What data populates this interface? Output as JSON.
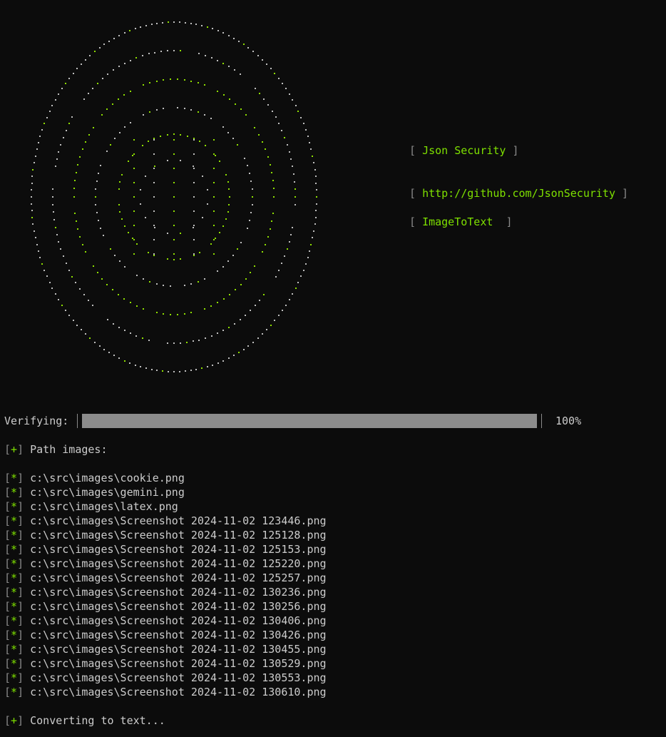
{
  "banner": {
    "name": "Json Security",
    "url": "http://github.com/JsonSecurity",
    "tool": "ImageToText"
  },
  "progress": {
    "label": "Verifying:",
    "percent_text": "100%",
    "value": 1.0
  },
  "sections": {
    "path_marker": "+",
    "path_label": "Path images:",
    "convert_marker": "+",
    "convert_label": "Converting to text..."
  },
  "files": [
    {
      "marker": "*",
      "path": "c:\\src\\images\\cookie.png"
    },
    {
      "marker": "*",
      "path": "c:\\src\\images\\gemini.png"
    },
    {
      "marker": "*",
      "path": "c:\\src\\images\\latex.png"
    },
    {
      "marker": "*",
      "path": "c:\\src\\images\\Screenshot 2024-11-02 123446.png"
    },
    {
      "marker": "*",
      "path": "c:\\src\\images\\Screenshot 2024-11-02 125128.png"
    },
    {
      "marker": "*",
      "path": "c:\\src\\images\\Screenshot 2024-11-02 125153.png"
    },
    {
      "marker": "*",
      "path": "c:\\src\\images\\Screenshot 2024-11-02 125220.png"
    },
    {
      "marker": "*",
      "path": "c:\\src\\images\\Screenshot 2024-11-02 125257.png"
    },
    {
      "marker": "*",
      "path": "c:\\src\\images\\Screenshot 2024-11-02 130236.png"
    },
    {
      "marker": "*",
      "path": "c:\\src\\images\\Screenshot 2024-11-02 130256.png"
    },
    {
      "marker": "*",
      "path": "c:\\src\\images\\Screenshot 2024-11-02 130406.png"
    },
    {
      "marker": "*",
      "path": "c:\\src\\images\\Screenshot 2024-11-02 130426.png"
    },
    {
      "marker": "*",
      "path": "c:\\src\\images\\Screenshot 2024-11-02 130455.png"
    },
    {
      "marker": "*",
      "path": "c:\\src\\images\\Screenshot 2024-11-02 130529.png"
    },
    {
      "marker": "*",
      "path": "c:\\src\\images\\Screenshot 2024-11-02 130553.png"
    },
    {
      "marker": "*",
      "path": "c:\\src\\images\\Screenshot 2024-11-02 130610.png"
    }
  ],
  "colors": {
    "background": "#0c0c0c",
    "text": "#cccccc",
    "accent_green": "#7ee000",
    "bracket_gray": "#8a8a8a",
    "progress_fill": "#8c8c8c",
    "ascii_gray": "#bfbfbf",
    "ascii_green": "#8fe000"
  },
  "logo": {
    "kind": "ascii-dot-art-logo"
  }
}
